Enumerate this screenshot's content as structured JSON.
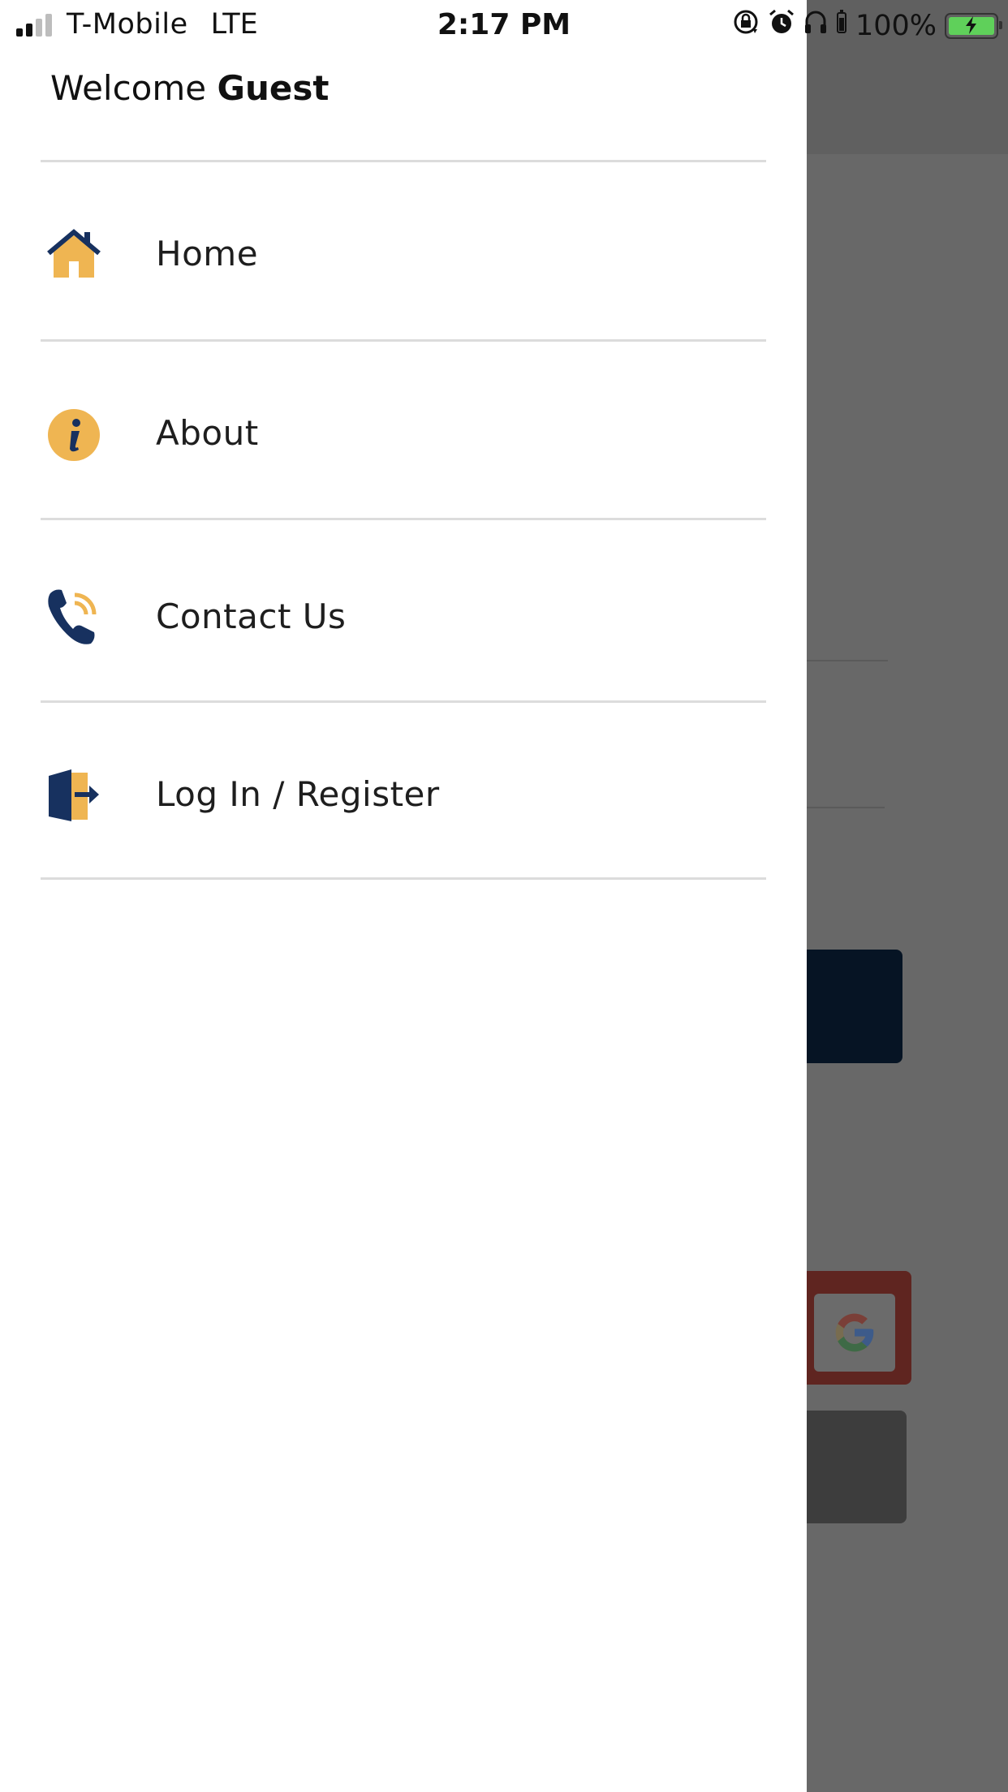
{
  "status_bar": {
    "carrier": "T-Mobile",
    "network": "LTE",
    "time": "2:17 PM",
    "battery": "100%"
  },
  "drawer": {
    "welcome_prefix": "Welcome",
    "welcome_name": "Guest",
    "items": [
      {
        "label": "Home",
        "icon": "home-icon"
      },
      {
        "label": "About",
        "icon": "info-icon"
      },
      {
        "label": "Contact Us",
        "icon": "phone-icon"
      },
      {
        "label": "Log In / Register",
        "icon": "login-icon"
      }
    ]
  },
  "colors": {
    "navy": "#17315f",
    "gold": "#efb552",
    "overlay": "#686868"
  }
}
